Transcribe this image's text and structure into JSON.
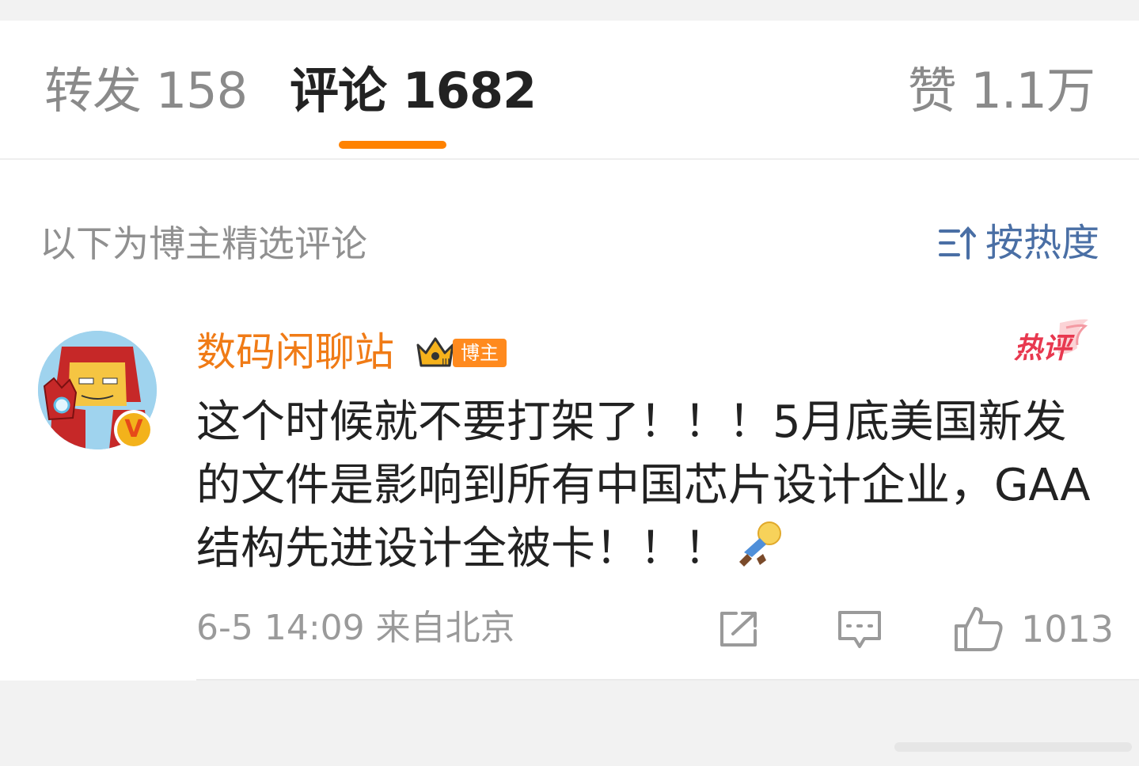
{
  "tabs": {
    "repost": "转发 158",
    "comments": "评论 1682",
    "likes": "赞 1.1万"
  },
  "colors": {
    "accent": "#ff8200",
    "username": "#f07b16",
    "sort": "#4a6fa5",
    "hot": "#e8384f"
  },
  "section": {
    "title": "以下为博主精选评论",
    "sort_label": "按热度"
  },
  "comment": {
    "username": "数码闲聊站",
    "badge_host": "博主",
    "badge_level": "III",
    "verified": "V",
    "hot_tag": "热评",
    "text": "这个时候就不要打架了！！！5月底美国新发的文件是影响到所有中国芯片设计企业，GAA结构先进设计全被卡！！！",
    "emoji": "sleeping-figure-emoji",
    "time_location": "6-5 14:09  来自北京",
    "like_count": "1013"
  },
  "icons": {
    "share": "share-icon",
    "reply": "comment-icon",
    "like": "thumbs-up-icon",
    "sort": "sort-icon",
    "crown": "crown-icon"
  }
}
